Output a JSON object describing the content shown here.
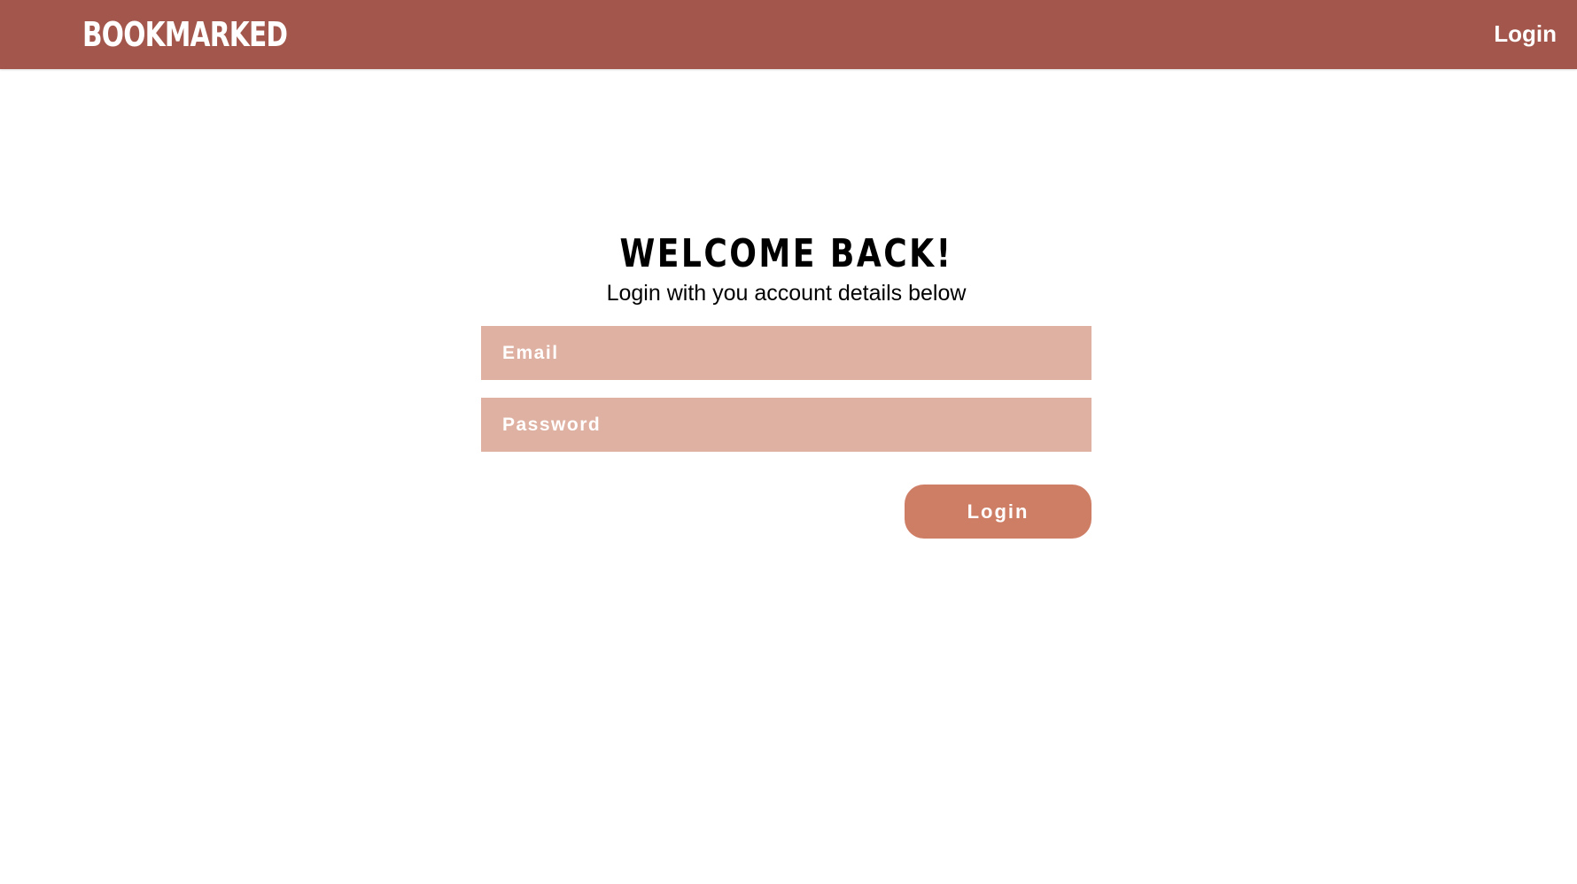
{
  "navbar": {
    "brand": "BOOKMARKED",
    "login_link": "Login"
  },
  "login_form": {
    "title": "WELCOME BACK!",
    "subtitle": "Login with you account details below",
    "email_placeholder": "Email",
    "email_value": "",
    "password_placeholder": "Password",
    "password_value": "",
    "submit_label": "Login"
  },
  "colors": {
    "navbar_background": "#a3564b",
    "input_background": "#dfb1a2",
    "button_background": "#cf7e66",
    "page_background": "#ffffff",
    "text_light": "#ffffff",
    "text_dark": "#000000"
  }
}
